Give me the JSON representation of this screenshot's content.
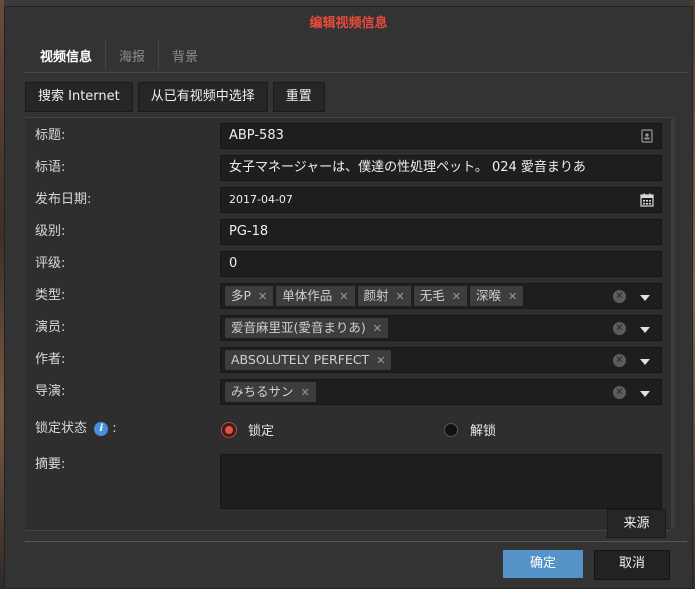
{
  "dialog": {
    "title": "编辑视频信息"
  },
  "tabs": [
    {
      "label": "视频信息",
      "active": true
    },
    {
      "label": "海报",
      "active": false
    },
    {
      "label": "背景",
      "active": false
    }
  ],
  "toolbar": {
    "search_internet": "搜索 Internet",
    "choose_existing": "从已有视频中选择",
    "reset": "重置"
  },
  "form": {
    "title": {
      "label": "标题:",
      "value": "ABP-583"
    },
    "tagline": {
      "label": "标语:",
      "value": "女子マネージャーは、僕達の性処理ペット。 024 愛音まりあ"
    },
    "release_date": {
      "label": "发布日期:",
      "value": "2017-04-07"
    },
    "certificate": {
      "label": "级别:",
      "value": "PG-18"
    },
    "rating": {
      "label": "评级:",
      "value": "0"
    },
    "genre": {
      "label": "类型:",
      "tags": [
        "多P",
        "单体作品",
        "颜射",
        "无毛",
        "深喉"
      ]
    },
    "actor": {
      "label": "演员:",
      "tags": [
        "爱音麻里亚(愛音まりあ)"
      ]
    },
    "writer": {
      "label": "作者:",
      "tags": [
        "ABSOLUTELY PERFECT"
      ]
    },
    "director": {
      "label": "导演:",
      "tags": [
        "みちるサン"
      ]
    },
    "lock": {
      "label": "锁定状态",
      "suffix": ":",
      "locked": "锁定",
      "unlocked": "解锁",
      "selected": "locked"
    },
    "summary": {
      "label": "摘要:",
      "value": ""
    }
  },
  "buttons": {
    "source": "来源",
    "ok": "确定",
    "cancel": "取消"
  },
  "colors": {
    "title": "#e84b3c",
    "primary": "#5693c9",
    "radio_selected": "#e0534a",
    "info": "#4a90d9"
  }
}
